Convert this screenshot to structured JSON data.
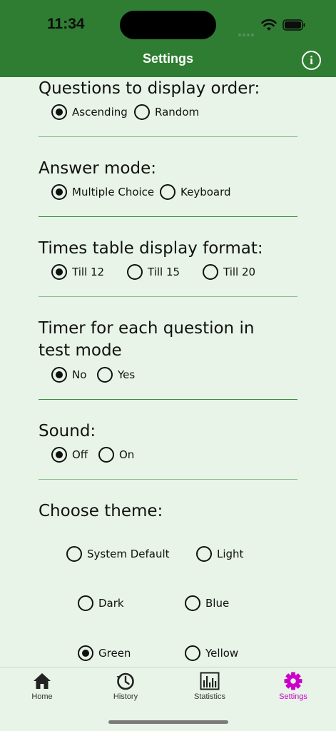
{
  "status_bar": {
    "time": "11:34"
  },
  "header": {
    "title": "Settings",
    "info_icon": "info-icon",
    "info_glyph": "i"
  },
  "sections": {
    "order": {
      "title": "Questions to display order:",
      "options": [
        "Ascending",
        "Random"
      ],
      "selected": "Ascending"
    },
    "answer_mode": {
      "title": "Answer mode:",
      "options": [
        "Multiple Choice",
        "Keyboard"
      ],
      "selected": "Multiple Choice"
    },
    "times_table": {
      "title": "Times table display format:",
      "options": [
        "Till 12",
        "Till 15",
        "Till 20"
      ],
      "selected": "Till 12"
    },
    "timer": {
      "title_line1": "Timer for each question in",
      "title_line2": "test mode",
      "options": [
        "No",
        "Yes"
      ],
      "selected": "No"
    },
    "sound": {
      "title": "Sound:",
      "options": [
        "Off",
        "On"
      ],
      "selected": "Off"
    },
    "theme": {
      "title": "Choose theme:",
      "options": [
        "System Default",
        "Light",
        "Dark",
        "Blue",
        "Green",
        "Yellow"
      ],
      "selected": "Green"
    }
  },
  "tabbar": {
    "items": [
      {
        "label": "Home",
        "icon": "home-icon"
      },
      {
        "label": "History",
        "icon": "history-icon"
      },
      {
        "label": "Statistics",
        "icon": "statistics-icon"
      },
      {
        "label": "Settings",
        "icon": "settings-icon"
      }
    ],
    "active": "Settings",
    "active_color": "#cc00cc"
  },
  "colors": {
    "header": "#2f7d32",
    "background": "#e7f4e7",
    "divider": "#8bbd8d"
  }
}
